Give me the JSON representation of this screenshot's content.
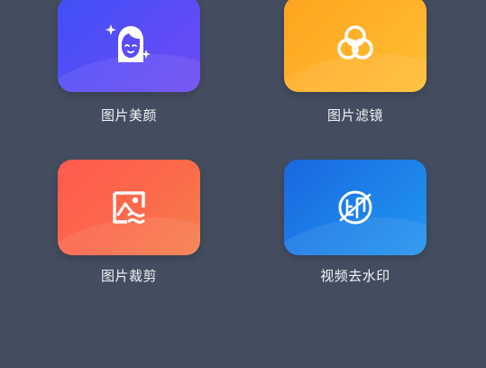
{
  "tools": [
    {
      "label": "图片美颜",
      "icon": "face-beauty-icon",
      "color": "#5b4cf7"
    },
    {
      "label": "图片滤镜",
      "icon": "filter-circles-icon",
      "color": "#ffb32a"
    },
    {
      "label": "图片裁剪",
      "icon": "image-crop-icon",
      "color": "#fb6a4a"
    },
    {
      "label": "视频去水印",
      "icon": "remove-watermark-icon",
      "color": "#1c82e9"
    }
  ]
}
